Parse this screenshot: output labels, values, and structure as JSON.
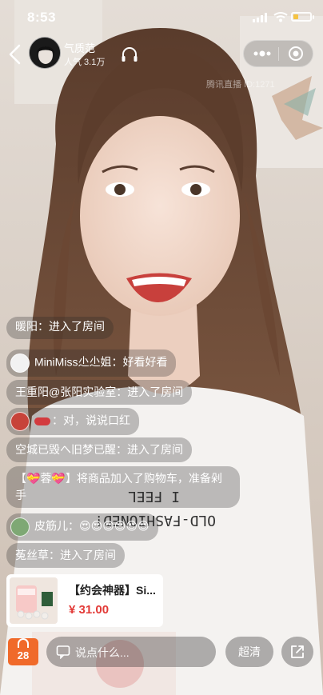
{
  "status_bar": {
    "time": "8:53"
  },
  "anchor": {
    "name": "气质范",
    "popularity": "人气 3.1万"
  },
  "watermark": "腾讯直播 ID:1271",
  "chat": [
    {
      "user": "暖阳：",
      "text": "进入了房间",
      "avatar": false
    },
    {
      "user": "MiniMiss尐尐姐：",
      "text": "好看好看",
      "avatar": true
    },
    {
      "user": "王重阳@张阳实验室：",
      "text": "进入了房间",
      "avatar": false
    },
    {
      "user": "：",
      "text": "对，说说口红",
      "avatar": true
    },
    {
      "user": "空城已毁へ旧梦已醒：",
      "text": "进入了房间",
      "avatar": false
    },
    {
      "user": "【💝蓉💝】",
      "text": "将商品加入了购物车，准备剁手",
      "avatar": false
    },
    {
      "user": "皮筋儿：",
      "text": "😍😍😍😍😍😍",
      "avatar": true
    },
    {
      "user": "菟丝草：",
      "text": "进入了房间",
      "avatar": false
    }
  ],
  "product": {
    "title": "【约会神器】Si...",
    "price": "¥ 31.00"
  },
  "bottom_bar": {
    "cart_count": "28",
    "comment_placeholder": "说点什么...",
    "quality_label": "超清"
  }
}
